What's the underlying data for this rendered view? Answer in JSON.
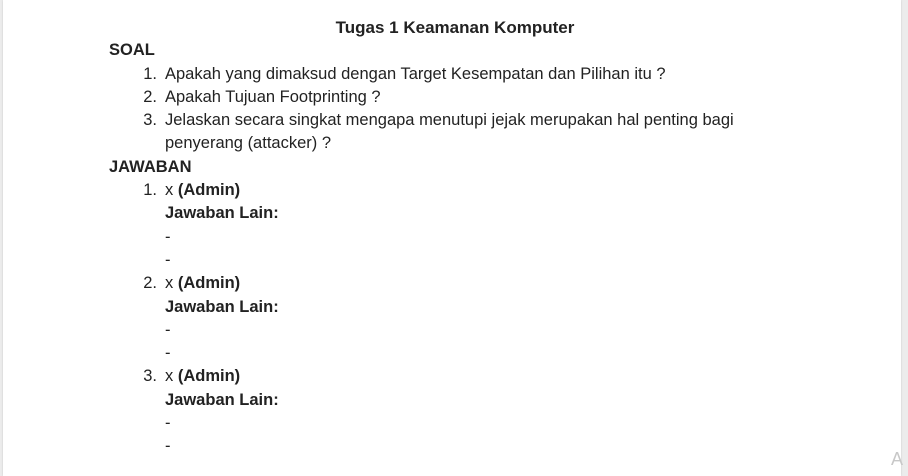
{
  "document": {
    "title": "Tugas 1 Keamanan Komputer",
    "soal_heading": "SOAL",
    "questions": [
      {
        "num": "1.",
        "text": "Apakah yang dimaksud dengan Target Kesempatan dan Pilihan itu ?"
      },
      {
        "num": "2.",
        "text": "Apakah Tujuan Footprinting ?"
      },
      {
        "num": "3.",
        "text": "Jelaskan secara singkat mengapa menutupi jejak merupakan hal penting bagi penyerang (attacker) ?"
      }
    ],
    "jawaban_heading": "JAWABAN",
    "answers": [
      {
        "num": "1.",
        "answer": "x",
        "author": "(Admin)",
        "alt_label": "Jawaban Lain:",
        "alts": [
          "-",
          "-"
        ]
      },
      {
        "num": "2.",
        "answer": "x",
        "author": "(Admin)",
        "alt_label": "Jawaban Lain:",
        "alts": [
          "-",
          "-"
        ]
      },
      {
        "num": "3.",
        "answer": "x",
        "author": "(Admin)",
        "alt_label": "Jawaban Lain:",
        "alts": [
          "-",
          "-"
        ]
      }
    ]
  },
  "watermark": "A"
}
